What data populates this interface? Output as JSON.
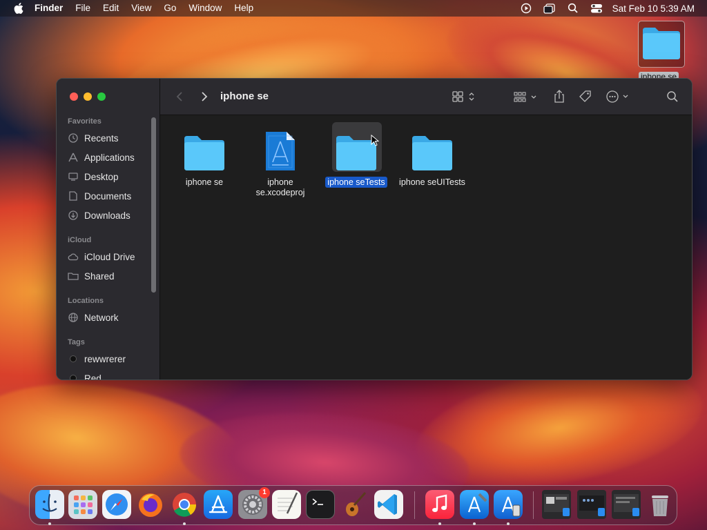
{
  "menubar": {
    "app_name": "Finder",
    "items": [
      "File",
      "Edit",
      "View",
      "Go",
      "Window",
      "Help"
    ],
    "clock": "Sat Feb 10  5:39 AM"
  },
  "desktop": {
    "icon_label": "iphone se"
  },
  "finder": {
    "title": "iphone se",
    "sidebar": {
      "favorites_label": "Favorites",
      "favorites": [
        "Recents",
        "Applications",
        "Desktop",
        "Documents",
        "Downloads"
      ],
      "icloud_label": "iCloud",
      "icloud": [
        "iCloud Drive",
        "Shared"
      ],
      "locations_label": "Locations",
      "locations": [
        "Network"
      ],
      "tags_label": "Tags",
      "tags": [
        "rewwrerer",
        "Red"
      ]
    },
    "files": [
      {
        "line1": "iphone se",
        "line2": "",
        "kind": "folder"
      },
      {
        "line1": "iphone",
        "line2": "se.xcodeproj",
        "kind": "xcodeproj"
      },
      {
        "line1": "iphone seTests",
        "line2": "",
        "kind": "folder"
      },
      {
        "line1": "iphone seUITests",
        "line2": "",
        "kind": "folder"
      }
    ],
    "selected_file": "iphone seTests"
  },
  "dock": {
    "apps": [
      "Finder",
      "Launchpad",
      "Safari",
      "Firefox",
      "Chrome",
      "App Store",
      "System Settings",
      "TextEdit",
      "Terminal",
      "GarageBand",
      "Visual Studio Code",
      "Music",
      "Xcode",
      "Simulator"
    ],
    "settings_badge": "1"
  },
  "colors": {
    "accent": "#1859c9",
    "folder": "#5ac8fa"
  }
}
